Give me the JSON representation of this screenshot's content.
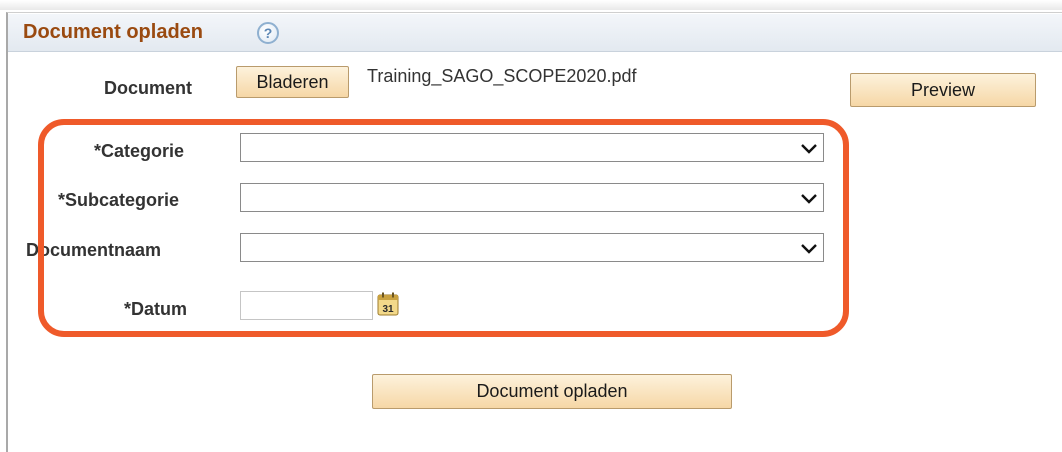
{
  "page": {
    "title": "Document opladen",
    "help_icon": "question-mark-icon"
  },
  "document": {
    "label": "Document",
    "browse_label": "Bladeren",
    "filename": "Training_SAGO_SCOPE2020.pdf",
    "preview_label": "Preview"
  },
  "fields": {
    "categorie_label": "*Categorie",
    "categorie_value": "",
    "subcategorie_label": "*Subcategorie",
    "subcategorie_value": "",
    "documentnaam_label": "Documentnaam",
    "documentnaam_value": "",
    "datum_label": "*Datum",
    "datum_value": "",
    "calendar_icon_text": "31"
  },
  "submit_label": "Document opladen",
  "colors": {
    "title": "#9a4a10",
    "highlight": "#ef5a2a",
    "button_top": "#fdf2dc",
    "button_bottom": "#f6d7a6"
  }
}
